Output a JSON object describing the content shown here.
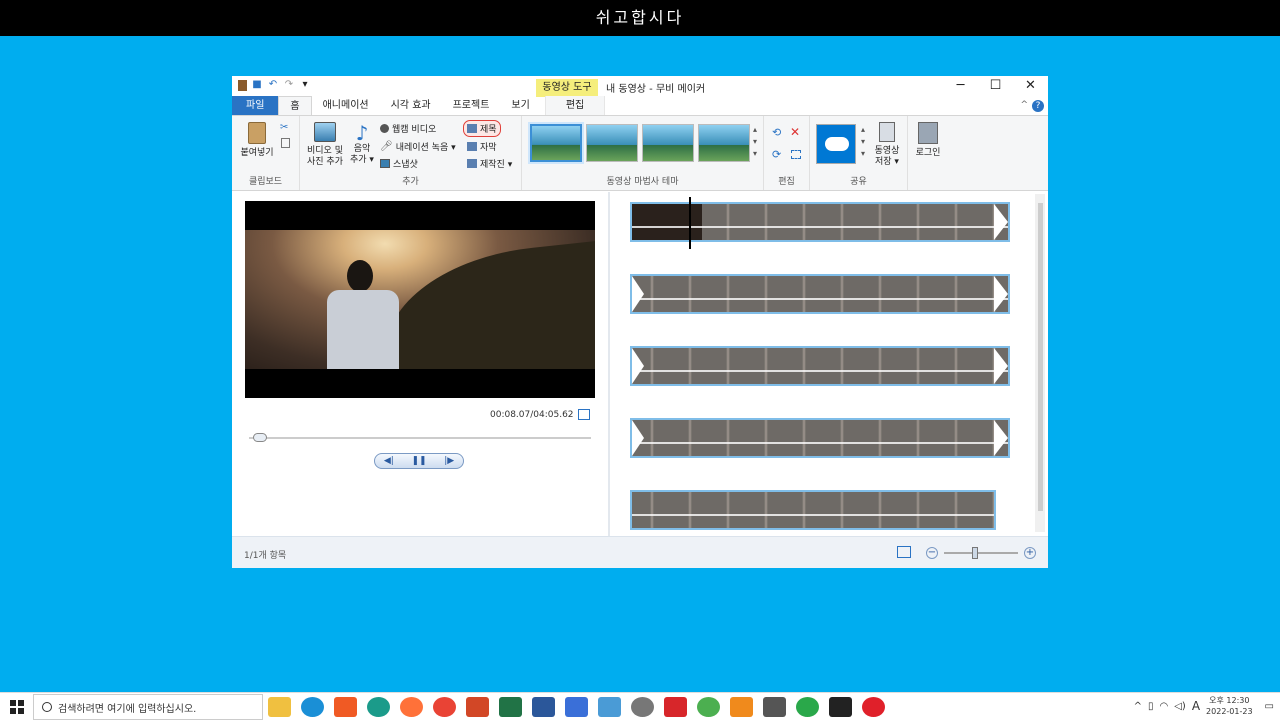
{
  "banner": {
    "text": "쉬고합시다"
  },
  "window": {
    "context_tab": "동영상 도구",
    "title": "내 동영상 - 무비 메이커",
    "controls": {
      "minimize": "─",
      "maximize": "☐",
      "close": "✕"
    },
    "help": "?",
    "collapse": "^"
  },
  "tabs": [
    {
      "label": "파일"
    },
    {
      "label": "홈"
    },
    {
      "label": "애니메이션"
    },
    {
      "label": "시각 효과"
    },
    {
      "label": "프로젝트"
    },
    {
      "label": "보기"
    },
    {
      "label": "편집"
    }
  ],
  "ribbon": {
    "clipboard": {
      "paste": "붙여넣기",
      "group": "클립보드"
    },
    "add": {
      "add_video_l1": "비디오 및",
      "add_video_l2": "사진 추가",
      "add_music_l1": "음악",
      "add_music_l2": "추가 ▾",
      "webcam": "웹캠 비디오",
      "narration": "내레이션 녹음 ▾",
      "snapshot": "스냅샷",
      "title": "제목",
      "caption": "자막",
      "credits": "제작진 ▾",
      "group": "추가"
    },
    "themes": {
      "group": "동영상 마법사 테마"
    },
    "edit": {
      "group": "편집"
    },
    "share": {
      "save_l1": "동영상",
      "save_l2": "저장 ▾",
      "group": "공유"
    },
    "signin": {
      "label": "로그인"
    }
  },
  "player": {
    "timecode": "00:08.07/04:05.62",
    "progress": 0.033,
    "prev": "◀|",
    "pause": "❚❚",
    "next": "|▶"
  },
  "storyboard": {
    "clip_count": 5
  },
  "status": {
    "items": "1/1개 항목",
    "zoom_out": "−",
    "zoom_in": "+"
  },
  "taskbar": {
    "search_placeholder": "검색하려면 여기에 입력하십시오.",
    "ime": "A",
    "time": "오후 12:30",
    "date": "2022-01-23"
  }
}
